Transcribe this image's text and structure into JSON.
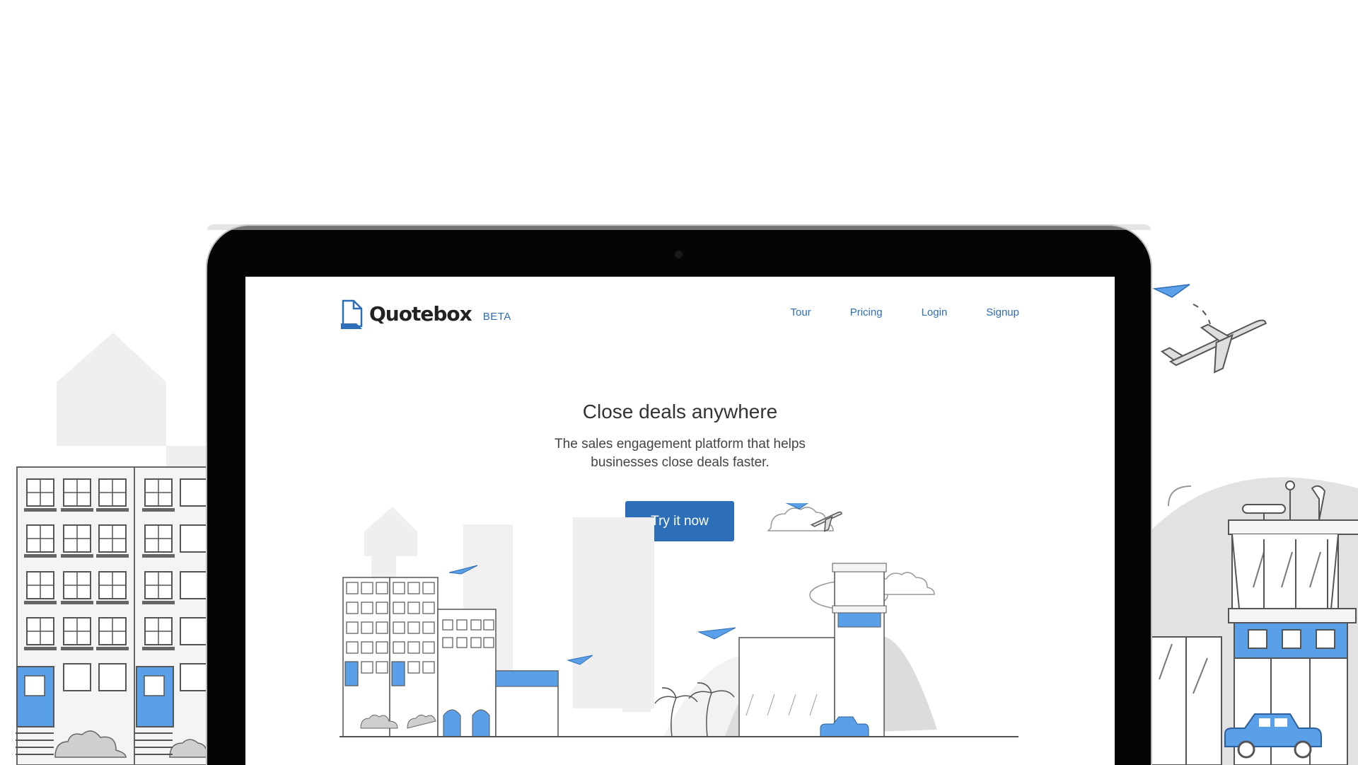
{
  "brand": {
    "name": "Quotebox",
    "tag": "BETA"
  },
  "nav": {
    "items": [
      {
        "label": "Tour"
      },
      {
        "label": "Pricing"
      },
      {
        "label": "Login"
      },
      {
        "label": "Signup"
      }
    ]
  },
  "hero": {
    "title": "Close deals anywhere",
    "subtitle_line1": "The sales engagement platform that helps",
    "subtitle_line2": "businesses close deals faster.",
    "cta_label": "Try it now"
  },
  "colors": {
    "accent": "#2c6eb8",
    "link": "#2f6db5",
    "illustration_blue": "#5aa0e8"
  }
}
